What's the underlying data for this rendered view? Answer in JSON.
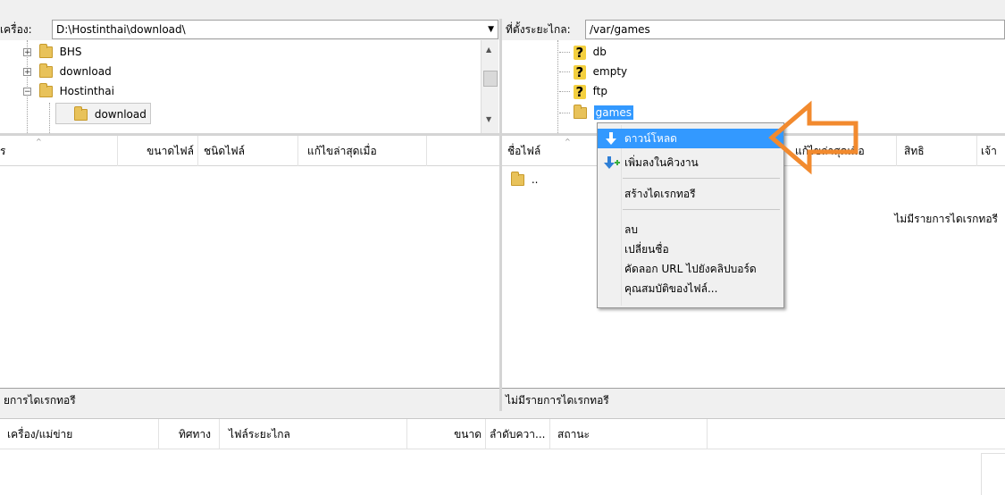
{
  "local": {
    "path_label": "เครื่อง:",
    "path_value": "D:\\Hostinthai\\download\\",
    "tree": [
      {
        "label": "BHS",
        "expander": "+"
      },
      {
        "label": "download",
        "expander": "+"
      },
      {
        "label": "Hostinthai",
        "expander": "−"
      },
      {
        "label": "download",
        "expander": ""
      }
    ],
    "columns": [
      "ขนาดไฟล์",
      "ชนิดไฟล์",
      "แก้ไขล่าสุดเมื่อ"
    ],
    "status": "ยการไดเรกทอรี"
  },
  "remote": {
    "path_label": "ที่ตั้งระยะไกล:",
    "path_value": "/var/games",
    "tree": [
      {
        "label": "db",
        "icon": "question"
      },
      {
        "label": "empty",
        "icon": "question"
      },
      {
        "label": "ftp",
        "icon": "question"
      },
      {
        "label": "games",
        "icon": "folder"
      }
    ],
    "columns": [
      "ชื่อไฟล์",
      "แก้ไขล่าสุดเมื่อ",
      "สิทธิ",
      "เจ้า"
    ],
    "parent_dir": "..",
    "empty_message": "ไม่มีรายการไดเรกทอรี",
    "status": "ไม่มีรายการไดเรกทอรี"
  },
  "context_menu": {
    "items": [
      {
        "label": "ดาวน์โหลด"
      },
      {
        "label": "เพิ่มลงในคิวงาน"
      },
      {
        "label": "สร้างไดเรกทอรี"
      },
      {
        "label": "ลบ"
      },
      {
        "label": "เปลี่ยนชื่อ"
      },
      {
        "label": "คัดลอก URL ไปยังคลิปบอร์ด"
      },
      {
        "label": "คุณสมบัติของไฟล์..."
      }
    ]
  },
  "queue": {
    "columns": [
      "เครื่อง/แม่ข่าย",
      "ทิศทาง",
      "ไฟล์ระยะไกล",
      "ขนาด",
      "ลำดับควา...",
      "สถานะ"
    ]
  },
  "colors": {
    "highlight": "#3399ff",
    "arrow": "#f28a2e"
  }
}
